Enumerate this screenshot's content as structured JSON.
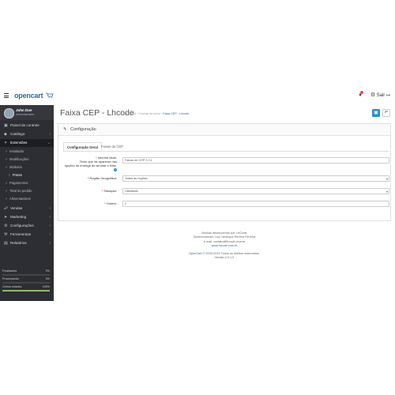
{
  "header": {
    "logo_text": "opencart",
    "user_label": "Sair",
    "notifications_count": "1",
    "icons": [
      "menu-icon",
      "cart-icon",
      "bell-icon",
      "gear-icon",
      "logout-icon"
    ]
  },
  "sidebar": {
    "profile": {
      "name": "John Doe",
      "role": "Administrador"
    },
    "items": [
      {
        "label": "Painel de controle",
        "icon": "dashboard-icon"
      },
      {
        "label": "Catálogo",
        "icon": "tag-icon"
      },
      {
        "label": "Extensões",
        "icon": "puzzle-icon"
      },
      {
        "label": "Instalador"
      },
      {
        "label": "Modificações"
      },
      {
        "label": "Módulos"
      },
      {
        "label": "Fretes"
      },
      {
        "label": "Pagamentos"
      },
      {
        "label": "Total do pedido"
      },
      {
        "label": "Alimentadores"
      },
      {
        "label": "Vendas",
        "icon": "cart-icon"
      },
      {
        "label": "Marketing",
        "icon": "share-icon"
      },
      {
        "label": "Configurações",
        "icon": "gear-icon"
      },
      {
        "label": "Ferramentas",
        "icon": "wrench-icon"
      },
      {
        "label": "Relatórios",
        "icon": "chart-icon"
      }
    ],
    "stats": [
      {
        "label": "Finalizados",
        "value": "0%",
        "progress": 0,
        "color": "#e3503e"
      },
      {
        "label": "Processando",
        "value": "0%",
        "progress": 0,
        "color": "#f38733"
      },
      {
        "label": "Outros estados",
        "value": "100%",
        "progress": 1,
        "color": "#8fbb6c"
      }
    ]
  },
  "page": {
    "title": "Faixa CEP - Lhcode",
    "breadcrumbs": [
      "Principal",
      "Formas de envio",
      "Faixa CEP - Lhcode"
    ],
    "panel_title": "Configuração",
    "tabs": [
      "Configuração Geral",
      "Faixas de CEP"
    ],
    "form": {
      "info_label": "Informe titulo:",
      "info_sub": "Texto que irá aparecer nas",
      "info_sub2": "opções de entrega ao simular o frete.",
      "info_value": "Faixas de CEP 2.0.1",
      "region_label": "Região Geográfica:",
      "region_value": "Todas as regiões",
      "status_label": "Situação:",
      "status_value": "Habilitado",
      "order_label": "Ordem:",
      "order_value": "2"
    },
    "footer": {
      "line1": "Modulo desenvolvido por LHCode",
      "line2": "Desenvolvedor: Luiz Henrique Pereira Ferreira",
      "line3": "e-mail: contato@lhcode.com.br",
      "line4": "www.lhcode.com.br",
      "line5": "OpenCart © 2009-2015 Todos os direitos reservados.",
      "line6": "Versão 2.0.1.0"
    }
  },
  "colors": {
    "accent": "#1e91cf",
    "sidebar_bg": "#2c2e33",
    "brand": "#2a6aa4"
  }
}
